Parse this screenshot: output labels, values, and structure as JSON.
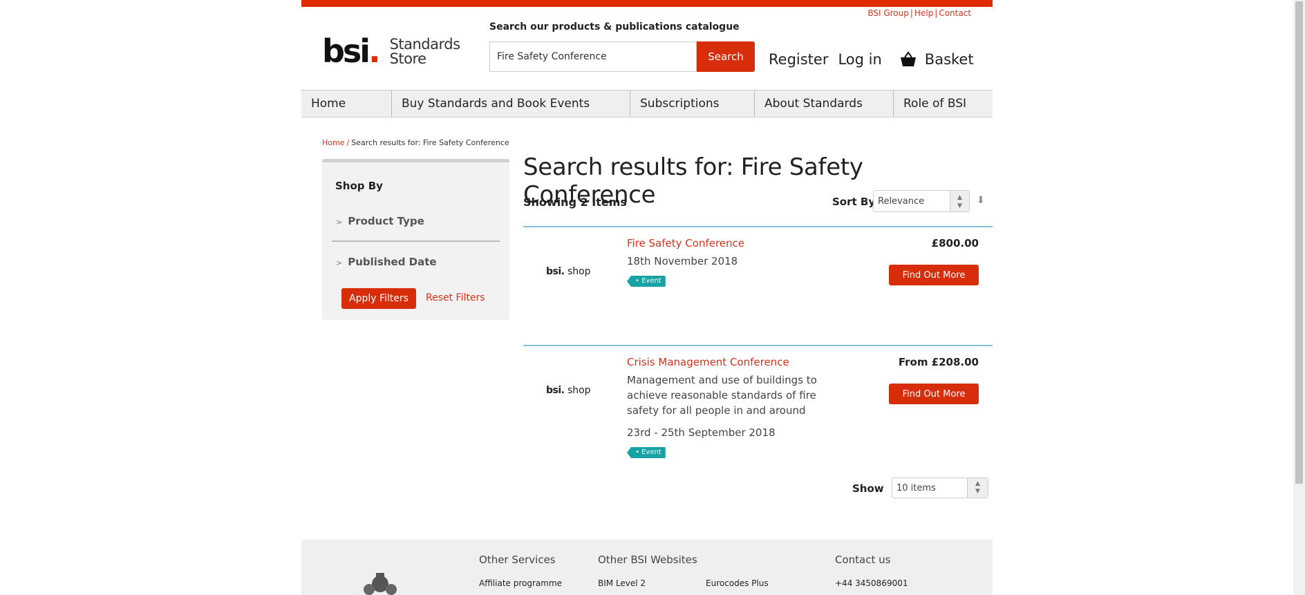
{
  "utility_links": [
    "BSI Group",
    "Help",
    "Contact"
  ],
  "utility_sep": "|",
  "logo": {
    "brand": "bsi",
    "dot": ".",
    "store_line1": "Standards",
    "store_line2": "Store"
  },
  "search": {
    "label": "Search our products & publications catalogue",
    "value": "Fire Safety Conference",
    "button": "Search"
  },
  "account": {
    "register": "Register",
    "login": "Log in",
    "basket": "Basket"
  },
  "nav": [
    "Home",
    "Buy Standards and Book Events",
    "Subscriptions",
    "About Standards",
    "Role of BSI"
  ],
  "breadcrumb": {
    "home": "Home",
    "sep": "/",
    "current": "Search results for: Fire Safety Conference"
  },
  "sidebar": {
    "title": "Shop By",
    "filters": [
      "Product Type",
      "Published Date"
    ],
    "chevron": ">",
    "apply": "Apply Filters",
    "reset": "Reset Filters"
  },
  "results_header": {
    "title": "Search results for: Fire Safety Conference",
    "showing": "Showing 2 Items",
    "sort_label": "Sort By",
    "sort_value": "Relevance"
  },
  "results": [
    {
      "thumb_brand": "bsi.",
      "thumb_shop": "shop",
      "name": "Fire Safety Conference",
      "desc": "",
      "date": "18th November 2018",
      "tag": "Event",
      "price": "£800.00",
      "button": "Find Out More"
    },
    {
      "thumb_brand": "bsi.",
      "thumb_shop": "shop",
      "name": "Crisis Management Conference",
      "desc": "Management and use of buildings to achieve reasonable standards of fire safety for all people in and around",
      "date": "23rd - 25th September 2018",
      "tag": "Event",
      "price": "From £208.00",
      "button": "Find Out More"
    }
  ],
  "pager": {
    "show_label": "Show",
    "show_value": "10 items"
  },
  "footer": {
    "other_services": "Other Services",
    "other_bsi": "Other BSI Websites",
    "contact": "Contact us",
    "links": [
      "Affiliate programme",
      "BIM Level 2",
      "Eurocodes Plus",
      "+44 3450869001"
    ]
  },
  "colors": {
    "accent": "#d72d0b",
    "topbar": "#e02b00",
    "event_tag": "#17a3a3",
    "divider": "#7ec3dd"
  }
}
